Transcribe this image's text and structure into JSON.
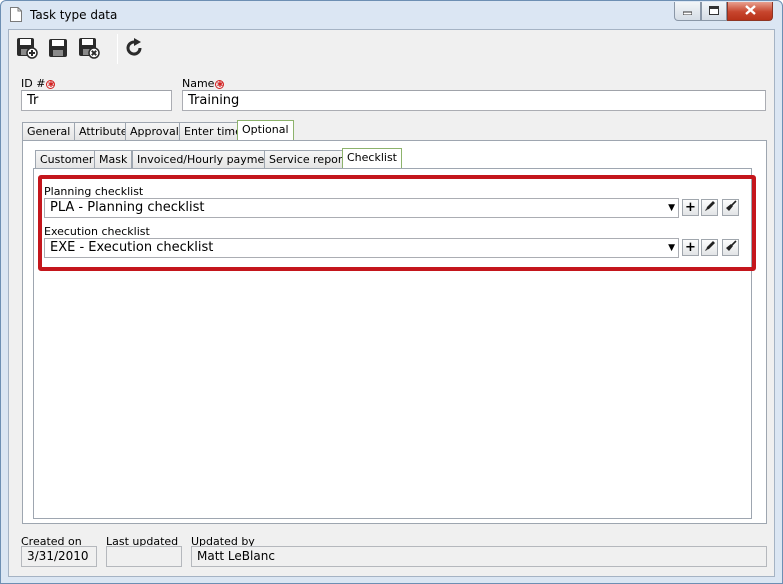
{
  "window": {
    "title": "Task type data",
    "minimize_icon": "minimize-icon",
    "maximize_icon": "maximize-icon",
    "close_icon": "close-icon"
  },
  "toolbar": {
    "buttons": [
      {
        "name": "save-and-new-button",
        "icon": "save-new-icon"
      },
      {
        "name": "save-button",
        "icon": "save-icon"
      },
      {
        "name": "save-and-close-button",
        "icon": "save-close-icon"
      },
      {
        "name": "refresh-button",
        "icon": "refresh-icon"
      }
    ]
  },
  "header": {
    "id_label": "ID #",
    "id_value": "Tr",
    "name_label": "Name",
    "name_value": "Training",
    "required_color": "#d42020"
  },
  "main_tabs": [
    {
      "label": "General"
    },
    {
      "label": "Attribute"
    },
    {
      "label": "Approval"
    },
    {
      "label": "Enter time"
    },
    {
      "label": "Optional",
      "active": true
    }
  ],
  "sub_tabs": [
    {
      "label": "Customer"
    },
    {
      "label": "Mask"
    },
    {
      "label": "Invoiced/Hourly payment"
    },
    {
      "label": "Service report"
    },
    {
      "label": "Checklist",
      "active": true
    }
  ],
  "checklist": {
    "planning_label": "Planning checklist",
    "planning_value": "PLA - Planning checklist",
    "execution_label": "Execution checklist",
    "execution_value": "EXE - Execution checklist",
    "highlight_color": "#c4161c"
  },
  "footer": {
    "created_on_label": "Created on",
    "created_on_value": "3/31/2010",
    "last_updated_label": "Last updated",
    "last_updated_value": "",
    "updated_by_label": "Updated by",
    "updated_by_value": "Matt LeBlanc"
  }
}
